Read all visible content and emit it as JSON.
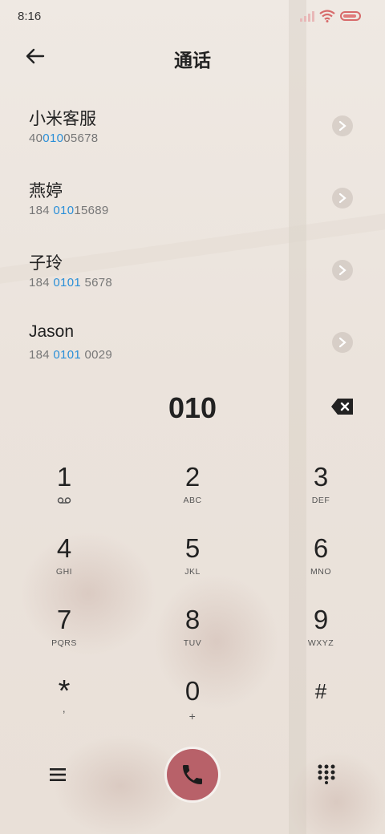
{
  "status_bar": {
    "time": "8:16"
  },
  "header": {
    "title": "通话"
  },
  "contacts": [
    {
      "name": "小米客服",
      "number_pre": "40",
      "number_match": "010",
      "number_post": "05678"
    },
    {
      "name": "燕婷",
      "number_pre": "184 ",
      "number_match": "010",
      "number_post": "15689"
    },
    {
      "name": "子玲",
      "number_pre": "184 ",
      "number_match": "0101",
      "number_post": " 5678"
    },
    {
      "name": "Jason",
      "number_pre": "184 ",
      "number_match": "0101",
      "number_post": " 0029"
    }
  ],
  "dialer": {
    "entered": "010"
  },
  "keypad": [
    {
      "num": "1",
      "sub": "",
      "icon": "voicemail-icon"
    },
    {
      "num": "2",
      "sub": "ABC"
    },
    {
      "num": "3",
      "sub": "DEF"
    },
    {
      "num": "4",
      "sub": "GHI"
    },
    {
      "num": "5",
      "sub": "JKL"
    },
    {
      "num": "6",
      "sub": "MNO"
    },
    {
      "num": "7",
      "sub": "PQRS"
    },
    {
      "num": "8",
      "sub": "TUV"
    },
    {
      "num": "9",
      "sub": "WXYZ"
    },
    {
      "num": "*",
      "sub": ","
    },
    {
      "num": "0",
      "sub": "+"
    },
    {
      "num": "#",
      "sub": ""
    }
  ],
  "colors": {
    "accent": "#2a8fd8",
    "call_button": "#b86169",
    "battery": "#d76a6a"
  },
  "icons": [
    "back-arrow-icon",
    "chevron-right-icon",
    "backspace-icon",
    "menu-icon",
    "phone-icon",
    "dialpad-icon",
    "wifi-icon",
    "signal-icon",
    "battery-icon"
  ]
}
